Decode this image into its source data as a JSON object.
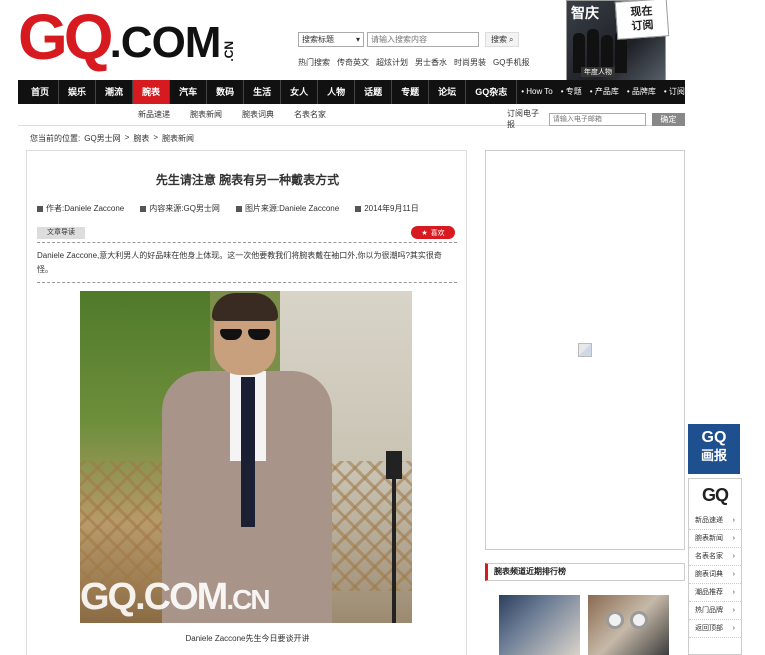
{
  "header": {
    "logo_gq": "GQ",
    "logo_com": ".COM",
    "logo_cn": ".CN",
    "search": {
      "select_value": "搜索标题",
      "placeholder": "请输入搜索内容",
      "button_label": "搜索"
    },
    "hot_search_label": "热门搜索",
    "hot_search_items": [
      "传奇英文",
      "超炫计划",
      "男士香水",
      "时尚男装",
      "GQ手机报"
    ],
    "magazine": {
      "title": "智庆",
      "tag": "年度人物",
      "subscribe_line1": "现在",
      "subscribe_line2": "订阅"
    }
  },
  "nav": {
    "items": [
      "首页",
      "娱乐",
      "潮流",
      "腕表",
      "汽车",
      "数码",
      "生活",
      "女人",
      "人物",
      "话题",
      "专题",
      "论坛",
      "GQ杂志"
    ],
    "active_index": 3,
    "small_items": [
      "• How To",
      "• 专题",
      "• 产品库",
      "• 品牌库",
      "• 订阅"
    ]
  },
  "subnav": {
    "links": [
      "新品速递",
      "腕表新闻",
      "腕表词典",
      "名表名家"
    ],
    "newsletter_label": "订阅电子报",
    "newsletter_placeholder": "请输入电子邮箱",
    "newsletter_button": "确定"
  },
  "breadcrumb": {
    "prefix": "您当前的位置:",
    "items": [
      "GQ男士网",
      ">",
      "腕表",
      ">",
      "腕表新闻"
    ]
  },
  "article": {
    "title": "先生请注意 腕表有另一种戴表方式",
    "meta": {
      "author": "作者:Daniele Zaccone",
      "source": "内容来源:GQ男士网",
      "image_source": "图片来源:Daniele Zaccone",
      "date": "2014年9月11日"
    },
    "intro_tab": "文章导读",
    "like_label": "喜欢",
    "summary": "Daniele Zaccone,意大利男人的好品味在他身上体现。这一次他要教我们将腕表戴在袖口外,你以为很潮吗?其实很奇怪。",
    "photo_watermark": "GQ.COM",
    "photo_watermark_cn": ".CN",
    "caption": "Daniele Zaccone先生今日要谈开讲"
  },
  "sidebar": {
    "ranking_title": "腕表频道近期排行榜"
  },
  "floating": {
    "badge_line1": "GQ",
    "badge_line2": "画报",
    "logo": "GQ",
    "items": [
      "新品速递",
      "腕表新闻",
      "名表名家",
      "腕表词典",
      "潮品推荐",
      "热门品牌",
      "返回顶部"
    ]
  },
  "colors": {
    "brand_red": "#d71920",
    "nav_black": "#111111",
    "badge_blue": "#1e4f8f"
  }
}
